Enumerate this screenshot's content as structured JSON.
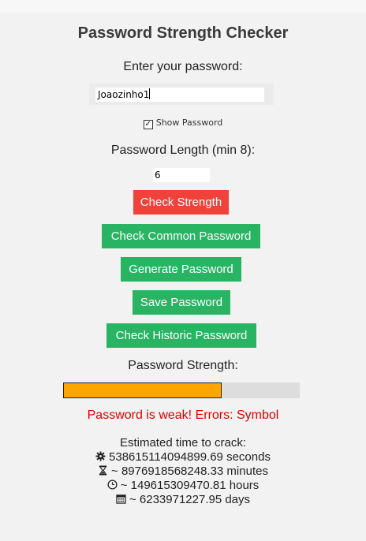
{
  "title": "Password Strength Checker",
  "password": {
    "label": "Enter your password:",
    "value": "Joaozinho1"
  },
  "show_password": {
    "label": "Show Password",
    "checked": true
  },
  "length": {
    "label": "Password Length (min 8):",
    "value": "6"
  },
  "buttons": {
    "check_strength": "Check Strength",
    "check_common": "Check Common Password",
    "generate": "Generate Password",
    "save": "Save Password",
    "check_historic": "Check Historic Password"
  },
  "strength": {
    "label": "Password Strength:",
    "level_fraction": 0.67,
    "message": "Password is weak! Errors: Symbol"
  },
  "crack_time": {
    "heading": "Estimated time to crack:",
    "seconds": "538615114094899.69 seconds",
    "minutes": "~ 8976918568248.33 minutes",
    "hours": "~ 149615309470.81 hours",
    "days": "~ 6233971227.95 days"
  },
  "colors": {
    "check_strength_button": "#f0413b",
    "action_buttons": "#28b463",
    "meter_fill": "#ffa500",
    "weak_message": "#e00000"
  },
  "icons": {
    "seconds": "gear-icon",
    "minutes": "hourglass-icon",
    "hours": "clock-icon",
    "days": "calendar-icon"
  }
}
